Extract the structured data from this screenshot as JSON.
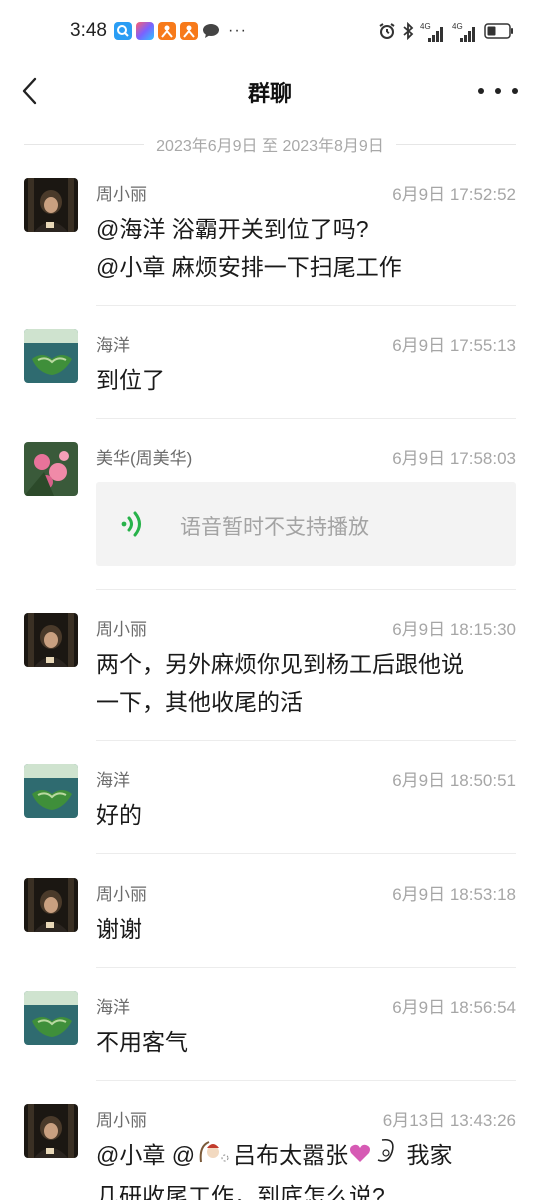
{
  "status_bar": {
    "time": "3:48",
    "ellipsis": "···",
    "signal_1_label": "4G",
    "signal_2_label": "4G",
    "icons": [
      "search-app-icon",
      "video-app-icon",
      "game-app-icon",
      "game-app-icon",
      "chat-bubble-icon",
      "alarm-icon",
      "bluetooth-icon",
      "signal-icon",
      "signal-icon",
      "battery-icon"
    ]
  },
  "nav": {
    "title": "群聊",
    "back_icon": "chevron-left-icon",
    "more_icon": "more-dots-icon"
  },
  "date_range": "2023年6月9日 至 2023年8月9日",
  "messages": [
    {
      "sender": "周小丽",
      "time": "6月9日 17:52:52",
      "lines": [
        "@海洋 浴霸开关到位了吗?",
        "@小章 麻烦安排一下扫尾工作"
      ]
    },
    {
      "sender": "海洋",
      "time": "6月9日 17:55:13",
      "lines": [
        "到位了"
      ]
    },
    {
      "sender": "美华(周美华)",
      "time": "6月9日 17:58:03",
      "voice_text": "语音暂时不支持播放"
    },
    {
      "sender": "周小丽",
      "time": "6月9日 18:15:30",
      "lines": [
        "两个，另外麻烦你见到杨工后跟他说",
        "一下，其他收尾的活"
      ]
    },
    {
      "sender": "海洋",
      "time": "6月9日 18:50:51",
      "lines": [
        "好的"
      ]
    },
    {
      "sender": "周小丽",
      "time": "6月9日 18:53:18",
      "lines": [
        "谢谢"
      ]
    },
    {
      "sender": "海洋",
      "time": "6月9日 18:56:54",
      "lines": [
        "不用客气"
      ]
    },
    {
      "sender": "周小丽",
      "time": "6月13日 13:43:26",
      "line_parts": [
        "@小章 @",
        "吕布太嚣张",
        "我家"
      ],
      "line2": "几研收尾工作，到底怎么说?"
    }
  ],
  "colors": {
    "voice_green": "#27b24a",
    "divider": "#ececec",
    "time_gray": "#a6a6a6",
    "sender_gray": "#6b6b6b"
  }
}
